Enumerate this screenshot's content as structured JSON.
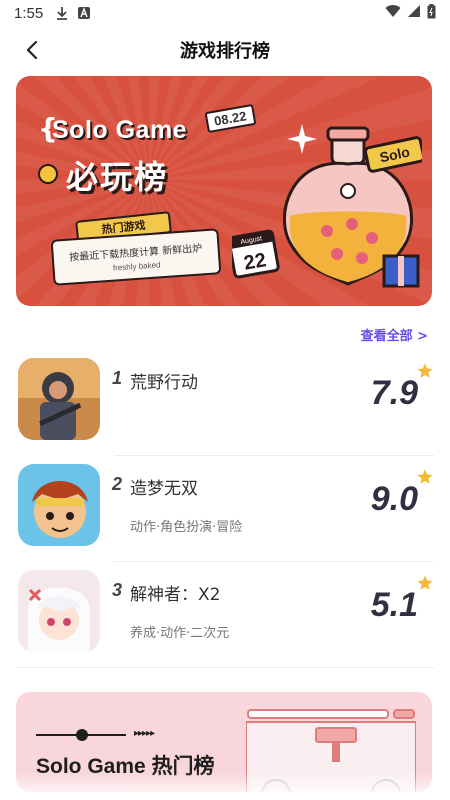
{
  "status_bar": {
    "time": "1:55",
    "icons": [
      "download-icon",
      "a-badge-icon",
      "wifi-icon",
      "signal-icon",
      "battery-icon"
    ]
  },
  "header": {
    "title": "游戏排行榜",
    "back_icon": "chevron-left-icon"
  },
  "banner": {
    "title_en": "Solo Game",
    "title_cn": "必玩榜",
    "date": "08.22",
    "tag": "热门游戏",
    "ticket_line1": "按最近下载热度计算 新鲜出炉",
    "ticket_line2": "freshly baked",
    "badge": "Solo",
    "calendar_month": "August",
    "calendar_day": "22"
  },
  "section": {
    "view_all": "查看全部 >"
  },
  "ranking": [
    {
      "rank": "1",
      "name": "荒野行动",
      "tags": "",
      "score": "7.9"
    },
    {
      "rank": "2",
      "name": "造梦无双",
      "tags": "动作·角色扮演·冒险",
      "score": "9.0"
    },
    {
      "rank": "3",
      "name": "解神者：X2",
      "tags": "养成·动作·二次元",
      "score": "5.1"
    }
  ],
  "banner2": {
    "title": "Solo  Game  热门榜"
  },
  "colors": {
    "accent": "#6a4de8",
    "banner_bg": "#d8513f",
    "star": "#f5b93a",
    "score": "#2f3142",
    "banner2_bg": "#f8d6db"
  }
}
